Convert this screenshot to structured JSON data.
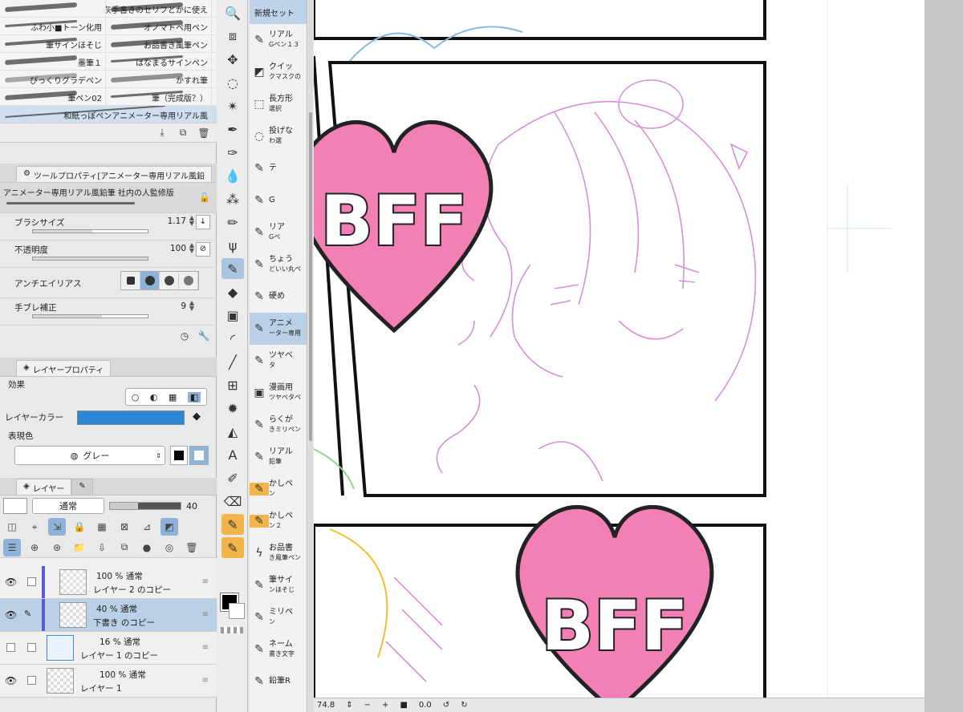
{
  "brushes": [
    {
      "left": "",
      "right": "Wフチ■黒白灰手書きのセリフとかに使え"
    },
    {
      "left": "ふわ小■トーン化用",
      "right": "オノマトペ用ペン"
    },
    {
      "left": "筆サインほそじ",
      "right": "お品書き風筆ペン"
    },
    {
      "left": "墨筆１",
      "right": "はなまるサインペン"
    },
    {
      "left": "ぴっくりグラデペン",
      "right": "かすれ筆"
    },
    {
      "left": "筆ペン02",
      "right": "筆（完成版？）"
    },
    {
      "left": "",
      "right": "和紙っぽペンアニメーター専用リアル風"
    }
  ],
  "tool_property": {
    "tab_label": "ツールプロパティ[アニメーター専用リアル風鉛",
    "preset_name": "アニメーター専用リアル風鉛筆 社内の人監修版",
    "brush_size_label": "ブラシサイズ",
    "brush_size_value": "1.17",
    "opacity_label": "不透明度",
    "opacity_value": "100",
    "antialias_label": "アンチエイリアス",
    "stabilization_label": "手ブレ補正",
    "stabilization_value": "9"
  },
  "layer_property": {
    "tab_label": "レイヤープロパティ",
    "effect_label": "効果",
    "layer_color_label": "レイヤーカラー",
    "layer_color": "#2b86d6",
    "expression_label": "表現色",
    "expression_value": "グレー"
  },
  "layers_panel": {
    "tab_label": "レイヤー",
    "blend_mode": "通常",
    "opacity": "40",
    "layers": [
      {
        "pct": "100 %  通常",
        "name": "レイヤー 2 のコピー",
        "visible": true
      },
      {
        "pct": "40 %  通常",
        "name": "下書き のコピー",
        "visible": true
      },
      {
        "pct": "16 %  通常",
        "name": "レイヤー 1 のコピー",
        "visible": false
      },
      {
        "pct": "100 %  通常",
        "name": "レイヤー 1",
        "visible": true
      }
    ]
  },
  "subtools": {
    "header": "新規セット",
    "items": [
      {
        "name": "リアル",
        "sub": "Gペン１３"
      },
      {
        "name": "クイッ",
        "sub": "クマスクの"
      },
      {
        "name": "長方形",
        "sub": "選択"
      },
      {
        "name": "投げな",
        "sub": "わ選"
      },
      {
        "name": "テ",
        "sub": ""
      },
      {
        "name": "G",
        "sub": ""
      },
      {
        "name": "リア",
        "sub": "Gペ"
      },
      {
        "name": "ちょう",
        "sub": "どいい丸ペ"
      },
      {
        "name": "硬め",
        "sub": ""
      },
      {
        "name": "アニメ",
        "sub": "ーター専用"
      },
      {
        "name": "ツヤベ",
        "sub": "タ"
      },
      {
        "name": "漫画用",
        "sub": "ツヤベタペ"
      },
      {
        "name": "らくが",
        "sub": "きミリペン"
      },
      {
        "name": "リアル",
        "sub": "鉛筆"
      },
      {
        "name": "かしペ",
        "sub": "ン"
      },
      {
        "name": "かしペ",
        "sub": "ン２"
      },
      {
        "name": "お品書",
        "sub": "き風筆ペン"
      },
      {
        "name": "筆サイ",
        "sub": "ンほそじ"
      },
      {
        "name": "ミリペ",
        "sub": "ン"
      },
      {
        "name": "ネーム",
        "sub": "書き文字"
      },
      {
        "name": "鉛筆R",
        "sub": ""
      }
    ]
  },
  "canvas": {
    "sticker_text": "BFF",
    "zoom": "74.8",
    "rotation": "0.0",
    "heart_color": "#f27fb5",
    "sketch_color": "#d98ed9"
  }
}
